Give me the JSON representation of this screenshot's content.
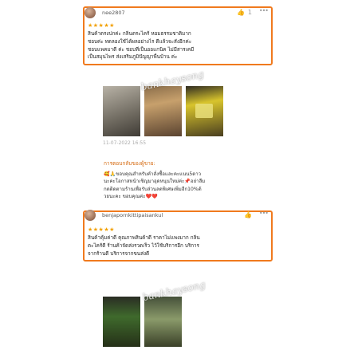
{
  "reviews": [
    {
      "username": "nee2807",
      "likes": "1",
      "stars": "★★★★★",
      "lines": [
        "สินค้าตรงปกค่ะ  กลิ่นตระไคร้ หอมธรรมชาติมาก",
        "ชอบค่ะ ทดลองใช้ได้ผลอย่างไร ดีแล้วจะสั่งอีกค่ะ",
        "ชอบแพคมาดี ค่ะ ชอบที่เป็นออแกนิค ไม่มีสารเคมี",
        "เป็นสมุนไพร ส่งเสริมภูมิปัญญาพื้นบ้าน ค่ะ"
      ],
      "date": "11-07-2022 16:55"
    },
    {
      "username": "benjapornkittipaisankul",
      "likes": "",
      "stars": "★★★★★",
      "lines": [
        "สินค้าคุ้มค่าดี คุณภาพสินค้าดี ราคาไม่แพงมาก กลิ่น",
        "ตะไคร้ดี ร้านค้าจัดส่งรวดเร็ว ไว้ใช้บริการอีก บริการ",
        "จากร้านดี บริการจากขนส่งดี"
      ]
    }
  ],
  "seller_reply": {
    "title": "การตอบกลับของผู้ขาย:",
    "lines": [
      "🥰🙏ขอบคุณสำหรับคำสั่งซื้อและคะแนน5ดาว",
      "นะคะโอกาสหน้าเชิญมาอุดหนุนใหม่ค่ะ📌อย่าลืม",
      "กดติดตามร้านเพื่อรับส่วนลดพิเศษเพิ่มอีก10%ด้",
      "วยนะคะ ขอบคุณค่ะ❤️❤️"
    ]
  },
  "watermark": "bankhaysong",
  "icons": {
    "like": "thumbs-up-icon",
    "more": "more-dots-icon"
  },
  "colors": {
    "highlight_border": "#f07a1e",
    "star": "#f2a000",
    "seller_title": "#d56a10"
  }
}
